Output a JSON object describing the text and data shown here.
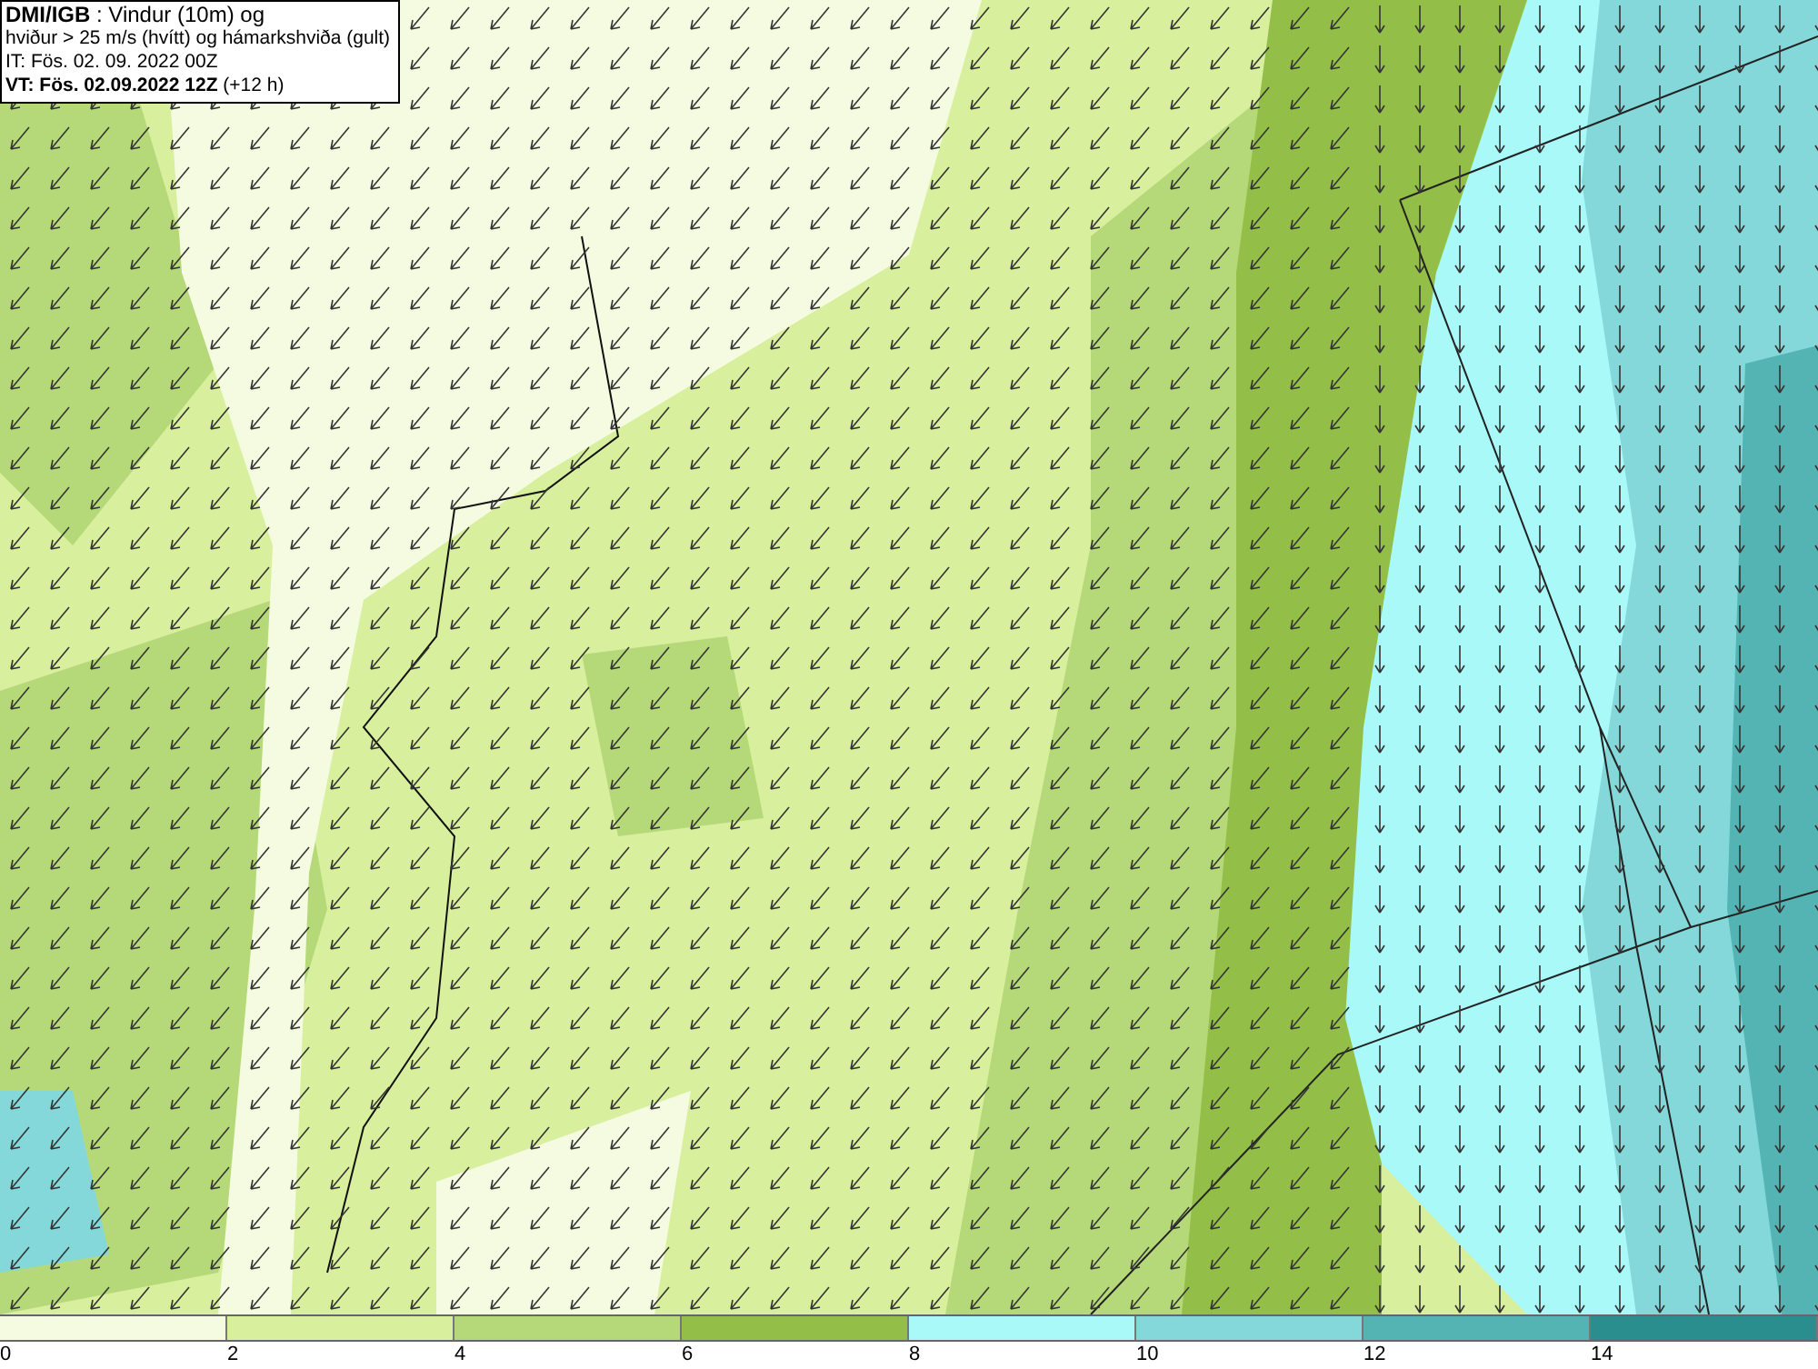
{
  "legend": {
    "lines": [
      "**DMI/IGB** : Vindur (10m) og",
      "hviður > 25 m/s (hvítt) og hámarkshviða (gult)",
      "IT: Fös. 02. 09. 2022 00Z",
      "**VT: Fös. 02.09.2022 12Z** (+12 h)"
    ]
  },
  "colorbar": {
    "segments": [
      {
        "color": "#f5fbe0"
      },
      {
        "color": "#d8ef9e"
      },
      {
        "color": "#b5d978"
      },
      {
        "color": "#93bf48"
      },
      {
        "color": "#aaf9f9"
      },
      {
        "color": "#84d8da"
      },
      {
        "color": "#54b4b4"
      },
      {
        "color": "#2a8e8e"
      }
    ],
    "ticks": [
      "0",
      "2",
      "4",
      "6",
      "8",
      "10",
      "12",
      "14"
    ]
  }
}
